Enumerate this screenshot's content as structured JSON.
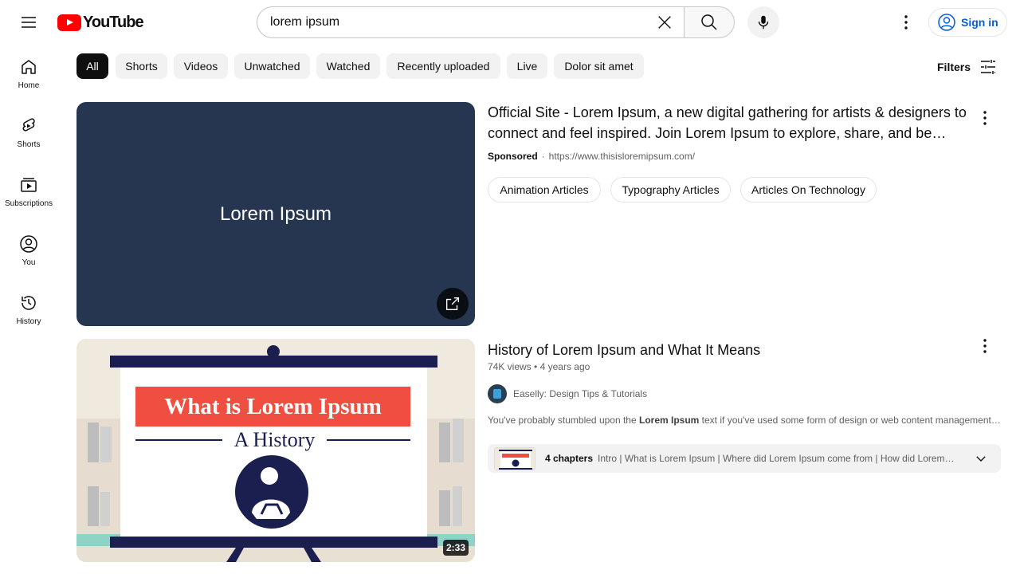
{
  "header": {
    "logo_text": "YouTube",
    "search_value": "lorem ipsum",
    "signin_label": "Sign in"
  },
  "sidebar": {
    "items": [
      {
        "label": "Home",
        "icon": "home-icon"
      },
      {
        "label": "Shorts",
        "icon": "shorts-icon"
      },
      {
        "label": "Subscriptions",
        "icon": "subscriptions-icon"
      },
      {
        "label": "You",
        "icon": "you-icon"
      },
      {
        "label": "History",
        "icon": "history-icon"
      }
    ]
  },
  "chips": [
    {
      "label": "All",
      "active": true
    },
    {
      "label": "Shorts"
    },
    {
      "label": "Videos"
    },
    {
      "label": "Unwatched"
    },
    {
      "label": "Watched"
    },
    {
      "label": "Recently uploaded"
    },
    {
      "label": "Live"
    },
    {
      "label": "Dolor sit amet"
    }
  ],
  "filters_label": "Filters",
  "ad": {
    "thumb_text": "Lorem Ipsum",
    "title": "Official Site - Lorem Ipsum, a new digital gathering for artists & designers to connect and feel inspired. Join Lorem Ipsum to explore, share, and be inspired.",
    "sponsored": "Sponsored",
    "url": "https://www.thisisloremipsum.com/",
    "chips": [
      "Animation Articles",
      "Typography Articles",
      "Articles On Technology"
    ]
  },
  "video": {
    "thumb_title": "What is Lorem Ipsum",
    "thumb_subtitle": "A History",
    "duration": "2:33",
    "title": "History of Lorem Ipsum and What It Means",
    "views": "74K views",
    "age": "4 years ago",
    "channel": "Easelly: Design Tips & Tutorials",
    "desc_before": "You've probably stumbled upon the ",
    "desc_bold": "Lorem Ipsum",
    "desc_after": " text if you've used some form of design or web content management software.",
    "chapters_count": "4 chapters",
    "chapters_list": "Intro | What is Lorem Ipsum | Where did Lorem Ipsum come from | How did Lorem Ipsum become popular"
  },
  "colors": {
    "brand_red": "#ff0000",
    "link_blue": "#065fd4",
    "ad_bg": "#263550",
    "thumb_red": "#f04e40",
    "thumb_navy": "#1a1f4f"
  }
}
